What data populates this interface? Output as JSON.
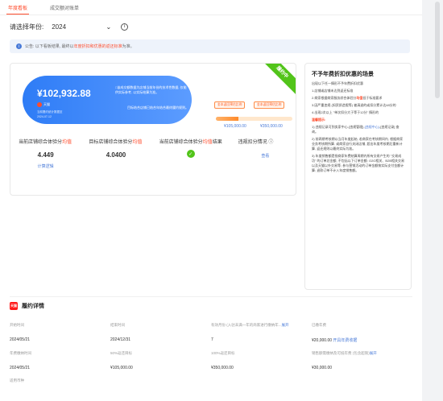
{
  "tabs": [
    "年度看板",
    "成交额对账单"
  ],
  "year_filter": {
    "label": "请选择年份:",
    "value": "2024"
  },
  "notice": {
    "text": "公告: 以下看板结果, 最终以",
    "highlight": "年度折扣和优惠的返还标准",
    "suffix": "为准。"
  },
  "card": {
    "corner": "履约中",
    "amount": "¥102,932.88",
    "badge": "天猫",
    "sub1": "当前履约统计数据至",
    "sub2": "2024-07-12",
    "desc1": "□该成交额数据为店铺当前年份的技术性数据, 仅能供实际参考, 以实际结算为准。",
    "desc2": "目标结合店铺已结合年结合最终履约规则。",
    "tags": [
      "金本返回预估比例",
      "金本返回预估比例"
    ],
    "progress": 0.29,
    "targets": [
      "¥105,000.00",
      "¥350,000.00"
    ]
  },
  "metrics": [
    {
      "title": "当前店铺综合体验分",
      "title_red": "均值",
      "value": "4.449",
      "link": "计算逻辑"
    },
    {
      "title": "目标店铺综合体验分",
      "title_red": "均值",
      "value": "4.0400"
    },
    {
      "title": "当前店铺综合体验分",
      "title_red": "均值",
      "title_suffix": "结果",
      "icon": "check-icon"
    },
    {
      "title": "违规扣分情况",
      "link": "查看"
    }
  ],
  "rules": {
    "title": "不予年费折扣优惠的场景",
    "p0": "出现以下任一情形不予年费折扣优惠",
    "p1": "1.店铺或店铺未达到返还标准",
    "p2a": "2.商家根据商家服务综合体验分",
    "p2r": "均值",
    "p2b": "低于标准要求",
    "p3": "3.因严重违规 (如资质造假等) 被清退的或扣分累计达48分的",
    "p4": "4.出现2次以上 \"单次扣分大于等于12分\" 情形的",
    "h2": "温馨提示:",
    "p5a": "1) 违规记录可到卖家中心-[违规管理]-",
    "p5b": "[违规中心]",
    "p5c": "-[违规记录] 查询。",
    "p6": "2) 前两期考核期以当月年度起始, 若商家在考核期间内, 根据商家业务考核期所算, 或商家自行关闭店铺, 超出年度考核期后重新计算, 返还规则以最终实际为准。",
    "p7": "3) 年度销售额是指商家年费结算周期内所有交易产生的 \"交易成功\" 的订单总金额, 不包括以下订单金额: O2O相关、B2B相关交易以及天猫以外交易等; 参与营销活动的订单金额按实际支付金额计算; 退款订单不计入年度销售额。"
  },
  "detail": {
    "title": "履约详情",
    "badge": "天猫",
    "row1": [
      {
        "label": "开始时间",
        "value": "2024/05/21"
      },
      {
        "label": "结束时间",
        "value": "2024/12/31"
      },
      {
        "label": "有效月份 (入驻未满一年的商家进行缴纳年...",
        "label_link": "展开",
        "value": "7"
      },
      {
        "label": "已缴年费",
        "value": "¥20,000.00",
        "value_link": "开具年费收据"
      }
    ],
    "row2": [
      {
        "label": "年费缴纳时间",
        "value": "2024/05/21"
      },
      {
        "label": "50%返还目标",
        "value": "¥105,000.00"
      },
      {
        "label": "100%返还目标",
        "value": "¥350,000.00"
      },
      {
        "label": "销售额需缴纳及可抵年费 (包含超限)",
        "label_link": "展开",
        "value": "¥30,000.00"
      }
    ],
    "currency_label": "适用币种"
  }
}
